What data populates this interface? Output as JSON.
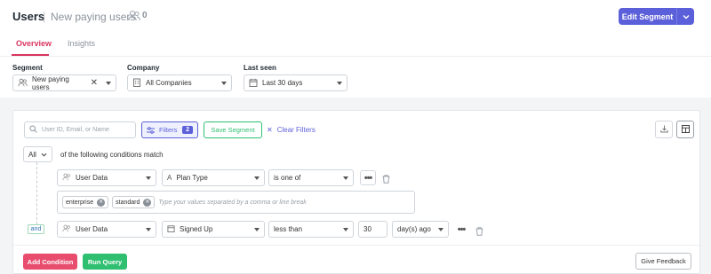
{
  "header": {
    "title": "Users",
    "separator": "|",
    "segment_name": "New paying users",
    "segment_count": "0",
    "edit_segment_label": "Edit Segment"
  },
  "tabs": [
    {
      "label": "Overview",
      "active": true
    },
    {
      "label": "Insights",
      "active": false
    }
  ],
  "filters_bar": {
    "segment": {
      "label": "Segment",
      "value": "New paying users"
    },
    "company": {
      "label": "Company",
      "value": "All Companies"
    },
    "last_seen": {
      "label": "Last seen",
      "value": "Last 30 days"
    }
  },
  "query": {
    "search_placeholder": "User ID, Email, or Name",
    "filters_label": "Filters",
    "filters_count": "2",
    "save_segment_label": "Save Segment",
    "clear_filters_label": "Clear Filters",
    "match_mode": "All",
    "match_text": "of the following conditions match",
    "and_label": "and",
    "condition1": {
      "source": "User Data",
      "property": "Plan Type",
      "operator": "is one of",
      "chips": [
        "enterprise",
        "standard"
      ],
      "values_placeholder": "Type your values separated by a comma or line break"
    },
    "condition2": {
      "source": "User Data",
      "property": "Signed Up",
      "operator": "less than",
      "amount": "30",
      "unit": "day(s) ago"
    },
    "add_condition_label": "Add Condition",
    "run_query_label": "Run Query",
    "give_feedback_label": "Give Feedback"
  },
  "colors": {
    "primary": "#5b5fd9",
    "active_tab": "#d8345f",
    "add_condition": "#e84d6e",
    "run_query": "#2fbf71",
    "save_segment": "#2fbf71"
  }
}
